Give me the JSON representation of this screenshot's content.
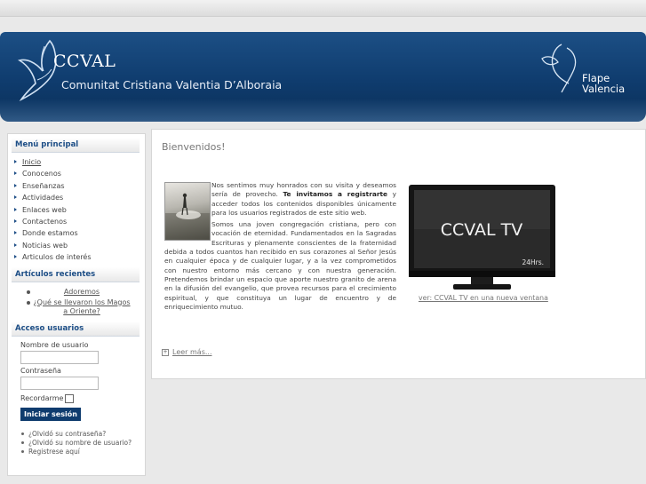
{
  "header": {
    "site_name": "CCVAL",
    "site_subtitle": "Comunitat Cristiana Valentia D’Alboraia",
    "partner_line1": "Flape",
    "partner_line2": "Valencia"
  },
  "sidebar": {
    "main_menu": {
      "title": "Menú principal",
      "items": [
        {
          "label": "Inicio"
        },
        {
          "label": "Conocenos"
        },
        {
          "label": "Enseñanzas"
        },
        {
          "label": "Actividades"
        },
        {
          "label": "Enlaces web"
        },
        {
          "label": "Contactenos"
        },
        {
          "label": "Donde estamos"
        },
        {
          "label": "Noticias web"
        },
        {
          "label": "Articulos de interés"
        }
      ]
    },
    "recent": {
      "title": "Artículos recientes",
      "items": [
        {
          "label": "Adoremos"
        },
        {
          "label": "¿Qué se llevaron los Magos a Oriente?"
        }
      ]
    },
    "login": {
      "title": "Acceso usuarios",
      "username_label": "Nombre de usuario",
      "username_value": "",
      "password_label": "Contraseña",
      "password_value": "",
      "remember_label": "Recordarme",
      "submit_label": "Iniciar sesión",
      "links": [
        {
          "label": "¿Olvidó su contraseña?"
        },
        {
          "label": "¿Olvidó su nombre de usuario?"
        },
        {
          "label": "Registrese aquí"
        }
      ]
    }
  },
  "main": {
    "title": "Bienvenidos!",
    "intro_before": "Nos sentimos muy honrados con su visita y deseamos sería de provecho. ",
    "intro_bold": "Te invitamos a registrarte",
    "intro_after": " y acceder todos los contenidos disponibles únicamente para los usuarios registrados de este sitio web.",
    "paragraph2": "Somos una joven congregación cristiana, pero con vocación de eternidad. Fundamentados en la Sagradas Escrituras y plenamente conscientes de la fraternidad debida a todos cuantos han recibido en sus corazones al Señor Jesús en cualquier época y de cualquier lugar, y a la vez comprometidos con nuestro entorno más cercano y con nuestra generación. Pretendemos brindar un espacio que aporte nuestro granito de arena en la difusión del evangelio, que provea recursos para el crecimiento espiritual, y que constituya un lugar de encuentro y de enriquecimiento mutuo.",
    "tv_screen_text": "CCVAL TV",
    "tv_badge": "24Hrs.",
    "tv_link": "ver: CCVAL TV en una nueva ventana",
    "read_more": "Leer más..."
  },
  "colors": {
    "header_blue": "#0f3c6e",
    "accent": "#1d4e86"
  }
}
